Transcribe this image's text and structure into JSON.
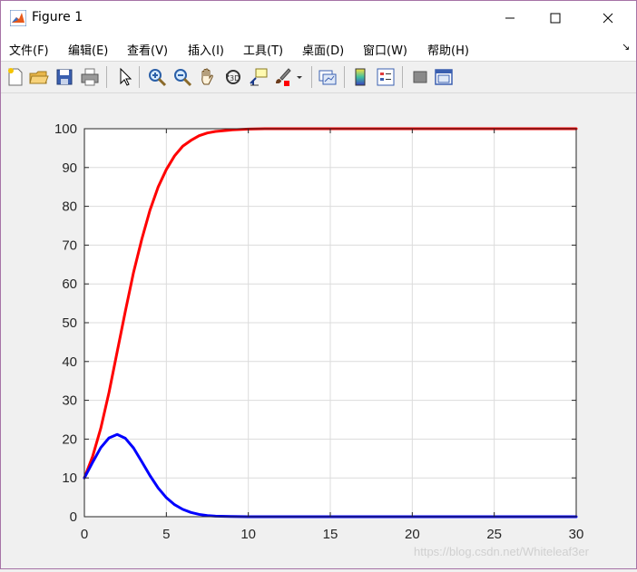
{
  "window": {
    "title": "Figure 1",
    "controls": {
      "minimize": "minimize-icon",
      "maximize": "maximize-icon",
      "close": "close-icon"
    }
  },
  "menu": {
    "items": [
      "文件(F)",
      "编辑(E)",
      "查看(V)",
      "插入(I)",
      "工具(T)",
      "桌面(D)",
      "窗口(W)",
      "帮助(H)"
    ],
    "overflow": "↘"
  },
  "toolbar": {
    "buttons": [
      "new-figure-icon",
      "open-file-icon",
      "save-icon",
      "print-icon",
      "pointer-icon",
      "zoom-in-icon",
      "zoom-out-icon",
      "pan-hand-icon",
      "rotate-3d-icon",
      "data-cursor-icon",
      "brush-icon",
      "brush-dropdown-icon",
      "link-plot-icon",
      "colorbar-icon",
      "legend-icon",
      "hide-plot-tools-icon",
      "show-plot-tools-icon"
    ]
  },
  "watermark": "https://blog.csdn.net/Whiteleaf3er",
  "chart_data": {
    "type": "line",
    "title": "",
    "xlabel": "",
    "ylabel": "",
    "xlim": [
      0,
      30
    ],
    "ylim": [
      0,
      100
    ],
    "xticks": [
      0,
      5,
      10,
      15,
      20,
      25,
      30
    ],
    "yticks": [
      0,
      10,
      20,
      30,
      40,
      50,
      60,
      70,
      80,
      90,
      100
    ],
    "grid": true,
    "legend": "none",
    "series": [
      {
        "color": "#ff0000",
        "x": [
          0,
          0.5,
          1,
          1.5,
          2,
          2.5,
          3,
          3.5,
          4,
          4.5,
          5,
          5.5,
          6,
          6.5,
          7,
          7.5,
          8,
          9,
          10,
          11,
          12,
          15,
          20,
          25,
          30
        ],
        "y": [
          10,
          15.5,
          22.8,
          32,
          42.5,
          53,
          63,
          71.5,
          79,
          85,
          89.5,
          93,
          95.5,
          97,
          98.2,
          98.9,
          99.3,
          99.7,
          99.9,
          100,
          100,
          100,
          100,
          100,
          100
        ]
      },
      {
        "color": "#0000ff",
        "x": [
          0,
          0.5,
          1,
          1.5,
          2,
          2.5,
          3,
          3.5,
          4,
          4.5,
          5,
          5.5,
          6,
          6.5,
          7,
          7.5,
          8,
          9,
          10,
          11,
          12,
          15,
          20,
          25,
          30
        ],
        "y": [
          10,
          14,
          17.8,
          20.3,
          21.2,
          20.2,
          17.7,
          14.2,
          10.6,
          7.4,
          4.9,
          3.1,
          1.9,
          1.1,
          0.6,
          0.3,
          0.15,
          0.05,
          0,
          0,
          0,
          0,
          0,
          0,
          0
        ]
      }
    ]
  }
}
